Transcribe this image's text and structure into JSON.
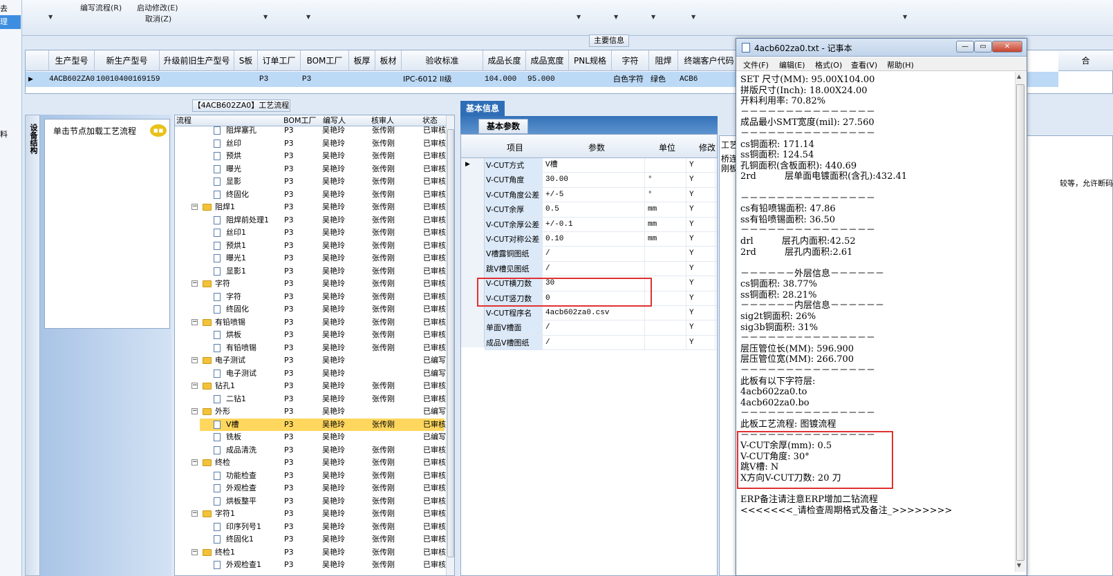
{
  "toolbar": {
    "items": [
      {
        "label": "编写流程(R)"
      },
      {
        "label": "启动修改(E)"
      },
      {
        "label": "取消(Z)"
      }
    ]
  },
  "left_strip": {
    "items": [
      "去",
      "理",
      "料"
    ]
  },
  "main_info": {
    "title": "主要信息",
    "columns": [
      "生产型号",
      "新生产型号",
      "升级前旧生产型号",
      "S板",
      "订单工厂",
      "BOM工厂",
      "板厚",
      "板材",
      "验收标准",
      "成品长度",
      "成品宽度",
      "PNL规格",
      "字符",
      "阻焊",
      "终端客户代码",
      "合"
    ],
    "row": [
      "4ACB602ZA0",
      "10010400169159",
      "",
      "",
      "P3",
      "P3",
      "",
      "",
      "IPC-6012 II级",
      "104.000",
      "95.000",
      "",
      "白色字符",
      "绿色",
      "ACB6"
    ]
  },
  "side_nav": {
    "vertical_tab": "设备结构",
    "hint": "单击节点加载工艺流程"
  },
  "process_tree": {
    "title": "【4ACB602ZA0】工艺流程",
    "columns": [
      "流程",
      "BOM工厂",
      "编写人",
      "核审人",
      "状态"
    ],
    "rows": [
      {
        "name": "阻焊塞孔",
        "type": "doc",
        "factory": "P3",
        "writer": "吴艳玲",
        "reviewer": "张传刚",
        "status": "已审核"
      },
      {
        "name": "丝印",
        "type": "doc",
        "factory": "P3",
        "writer": "吴艳玲",
        "reviewer": "张传刚",
        "status": "已审核"
      },
      {
        "name": "预烘",
        "type": "doc",
        "factory": "P3",
        "writer": "吴艳玲",
        "reviewer": "张传刚",
        "status": "已审核"
      },
      {
        "name": "曝光",
        "type": "doc",
        "factory": "P3",
        "writer": "吴艳玲",
        "reviewer": "张传刚",
        "status": "已审核"
      },
      {
        "name": "显影",
        "type": "doc",
        "factory": "P3",
        "writer": "吴艳玲",
        "reviewer": "张传刚",
        "status": "已审核"
      },
      {
        "name": "终固化",
        "type": "doc",
        "factory": "P3",
        "writer": "吴艳玲",
        "reviewer": "张传刚",
        "status": "已审核"
      },
      {
        "name": "阻焊1",
        "type": "folder",
        "factory": "P3",
        "writer": "吴艳玲",
        "reviewer": "张传刚",
        "status": "已审核"
      },
      {
        "name": "阻焊前处理1",
        "type": "doc",
        "factory": "P3",
        "writer": "吴艳玲",
        "reviewer": "张传刚",
        "status": "已审核"
      },
      {
        "name": "丝印1",
        "type": "doc",
        "factory": "P3",
        "writer": "吴艳玲",
        "reviewer": "张传刚",
        "status": "已审核"
      },
      {
        "name": "预烘1",
        "type": "doc",
        "factory": "P3",
        "writer": "吴艳玲",
        "reviewer": "张传刚",
        "status": "已审核"
      },
      {
        "name": "曝光1",
        "type": "doc",
        "factory": "P3",
        "writer": "吴艳玲",
        "reviewer": "张传刚",
        "status": "已审核"
      },
      {
        "name": "显影1",
        "type": "doc",
        "factory": "P3",
        "writer": "吴艳玲",
        "reviewer": "张传刚",
        "status": "已审核"
      },
      {
        "name": "字符",
        "type": "folder",
        "factory": "P3",
        "writer": "吴艳玲",
        "reviewer": "张传刚",
        "status": "已审核"
      },
      {
        "name": "字符",
        "type": "doc",
        "factory": "P3",
        "writer": "吴艳玲",
        "reviewer": "张传刚",
        "status": "已审核"
      },
      {
        "name": "终固化",
        "type": "doc",
        "factory": "P3",
        "writer": "吴艳玲",
        "reviewer": "张传刚",
        "status": "已审核"
      },
      {
        "name": "有铅喷锡",
        "type": "folder",
        "factory": "P3",
        "writer": "吴艳玲",
        "reviewer": "张传刚",
        "status": "已审核"
      },
      {
        "name": "烘板",
        "type": "doc",
        "factory": "P3",
        "writer": "吴艳玲",
        "reviewer": "张传刚",
        "status": "已审核"
      },
      {
        "name": "有铅喷锡",
        "type": "doc",
        "factory": "P3",
        "writer": "吴艳玲",
        "reviewer": "张传刚",
        "status": "已审核"
      },
      {
        "name": "电子测试",
        "type": "folder",
        "factory": "P3",
        "writer": "吴艳玲",
        "reviewer": "",
        "status": "已编写"
      },
      {
        "name": "电子测试",
        "type": "doc",
        "factory": "P3",
        "writer": "吴艳玲",
        "reviewer": "",
        "status": "已编写"
      },
      {
        "name": "钻孔1",
        "type": "folder",
        "factory": "P3",
        "writer": "吴艳玲",
        "reviewer": "张传刚",
        "status": "已审核"
      },
      {
        "name": "二钻1",
        "type": "doc",
        "factory": "P3",
        "writer": "吴艳玲",
        "reviewer": "张传刚",
        "status": "已审核"
      },
      {
        "name": "外形",
        "type": "folder",
        "factory": "P3",
        "writer": "吴艳玲",
        "reviewer": "",
        "status": "已编写"
      },
      {
        "name": "V槽",
        "type": "doc",
        "factory": "P3",
        "writer": "吴艳玲",
        "reviewer": "张传刚",
        "status": "已审核",
        "selected": true
      },
      {
        "name": "铣板",
        "type": "doc",
        "factory": "P3",
        "writer": "吴艳玲",
        "reviewer": "",
        "status": "已编写"
      },
      {
        "name": "成品清洗",
        "type": "doc",
        "factory": "P3",
        "writer": "吴艳玲",
        "reviewer": "张传刚",
        "status": "已审核"
      },
      {
        "name": "终检",
        "type": "folder",
        "factory": "P3",
        "writer": "吴艳玲",
        "reviewer": "张传刚",
        "status": "已审核"
      },
      {
        "name": "功能检查",
        "type": "doc",
        "factory": "P3",
        "writer": "吴艳玲",
        "reviewer": "张传刚",
        "status": "已审核"
      },
      {
        "name": "外观检查",
        "type": "doc",
        "factory": "P3",
        "writer": "吴艳玲",
        "reviewer": "张传刚",
        "status": "已审核"
      },
      {
        "name": "烘板整平",
        "type": "doc",
        "factory": "P3",
        "writer": "吴艳玲",
        "reviewer": "张传刚",
        "status": "已审核"
      },
      {
        "name": "字符1",
        "type": "folder",
        "factory": "P3",
        "writer": "吴艳玲",
        "reviewer": "张传刚",
        "status": "已审核"
      },
      {
        "name": "印序列号1",
        "type": "doc",
        "factory": "P3",
        "writer": "吴艳玲",
        "reviewer": "张传刚",
        "status": "已审核"
      },
      {
        "name": "终固化1",
        "type": "doc",
        "factory": "P3",
        "writer": "吴艳玲",
        "reviewer": "张传刚",
        "status": "已审核"
      },
      {
        "name": "终检1",
        "type": "folder",
        "factory": "P3",
        "writer": "吴艳玲",
        "reviewer": "张传刚",
        "status": "已审核"
      },
      {
        "name": "外观检查1",
        "type": "doc",
        "factory": "P3",
        "writer": "吴艳玲",
        "reviewer": "张传刚",
        "status": "已审核"
      }
    ]
  },
  "basic_info": {
    "tab": "基本信息",
    "subtab": "基本参数",
    "columns": [
      "项目",
      "参数",
      "单位",
      "修改"
    ],
    "rows": [
      {
        "item": "V-CUT方式",
        "value": "V槽",
        "unit": "",
        "flag": "Y"
      },
      {
        "item": "V-CUT角度",
        "value": "30.00",
        "unit": "°",
        "flag": "Y"
      },
      {
        "item": "V-CUT角度公差",
        "value": "+/-5",
        "unit": "°",
        "flag": "Y"
      },
      {
        "item": "V-CUT余厚",
        "value": "0.5",
        "unit": "mm",
        "flag": "Y"
      },
      {
        "item": "V-CUT余厚公差",
        "value": "+/-0.1",
        "unit": "mm",
        "flag": "Y"
      },
      {
        "item": "V-CUT对称公差",
        "value": "0.10",
        "unit": "mm",
        "flag": "Y"
      },
      {
        "item": "V槽露铜图纸",
        "value": "/",
        "unit": "",
        "flag": "Y"
      },
      {
        "item": "跳V槽见图纸",
        "value": "/",
        "unit": "",
        "flag": "Y"
      },
      {
        "item": "V-CUT横刀数",
        "value": "30",
        "unit": "",
        "flag": "Y"
      },
      {
        "item": "V-CUT竖刀数",
        "value": "0",
        "unit": "",
        "flag": "Y"
      },
      {
        "item": "V-CUT程序名",
        "value": "4acb602za0.csv",
        "unit": "",
        "flag": "Y"
      },
      {
        "item": "单面V槽面",
        "value": "/",
        "unit": "",
        "flag": "Y"
      },
      {
        "item": "成品V槽图纸",
        "value": "/",
        "unit": "",
        "flag": "Y"
      }
    ]
  },
  "right_panel": {
    "tab": "工艺",
    "lines": [
      "桥连",
      "刚板"
    ],
    "note": "较等，允许断码，"
  },
  "notepad": {
    "title": "4acb602za0.txt - 记事本",
    "menu": [
      "文件(F)",
      "编辑(E)",
      "格式(O)",
      "查看(V)",
      "帮助(H)"
    ],
    "lines": [
      "SET 尺寸(MM): 95.00X104.00",
      "拼版尺寸(Inch): 18.00X24.00",
      "开料利用率: 70.82%",
      "－－－－－－－－－－－－－－－",
      "成品最小SMT宽度(mil): 27.560",
      "－－－－－－－－－－－－－－－",
      "cs铜面积: 171.14",
      "ss铜面积: 124.54",
      "孔铜面积(含板面积): 440.69",
      "2rd          层单面电镀面积(含孔):432.41",
      "",
      "－－－－－－－－－－－－－－－",
      "cs有铅喷锡面积: 47.86",
      "ss有铅喷锡面积: 36.50",
      "－－－－－－－－－－－－－－－",
      "drl          层孔内面积:42.52",
      "2rd          层孔内面积:2.61",
      "",
      "－－－－－－外层信息－－－－－－",
      "cs铜面积: 38.77%",
      "ss铜面积: 28.21%",
      "－－－－－－内层信息－－－－－－",
      "sig2t铜面积: 26%",
      "sig3b铜面积: 31%",
      "－－－－－－－－－－－－－－－",
      "层压管位长(MM): 596.900",
      "层压管位宽(MM): 266.700",
      "－－－－－－－－－－－－－－－",
      "此板有以下字符层:",
      "4acb602za0.to",
      "4acb602za0.bo",
      "－－－－－－－－－－－－－－－",
      "此板工艺流程: 图镀流程",
      "－－－－－－－－－－－－－－－",
      "V-CUT余厚(mm): 0.5",
      "V-CUT角度: 30°",
      "跳V槽: N",
      "X方向V-CUT刀数: 20 刀",
      "",
      "ERP备注请注意ERP增加二钻流程",
      "<<<<<<<_请检查周期格式及备注_>>>>>>>>"
    ]
  },
  "colors": {
    "highlight": "#e03030",
    "selection": "#ffd75e",
    "grid_selected": "#bcd9f5"
  }
}
